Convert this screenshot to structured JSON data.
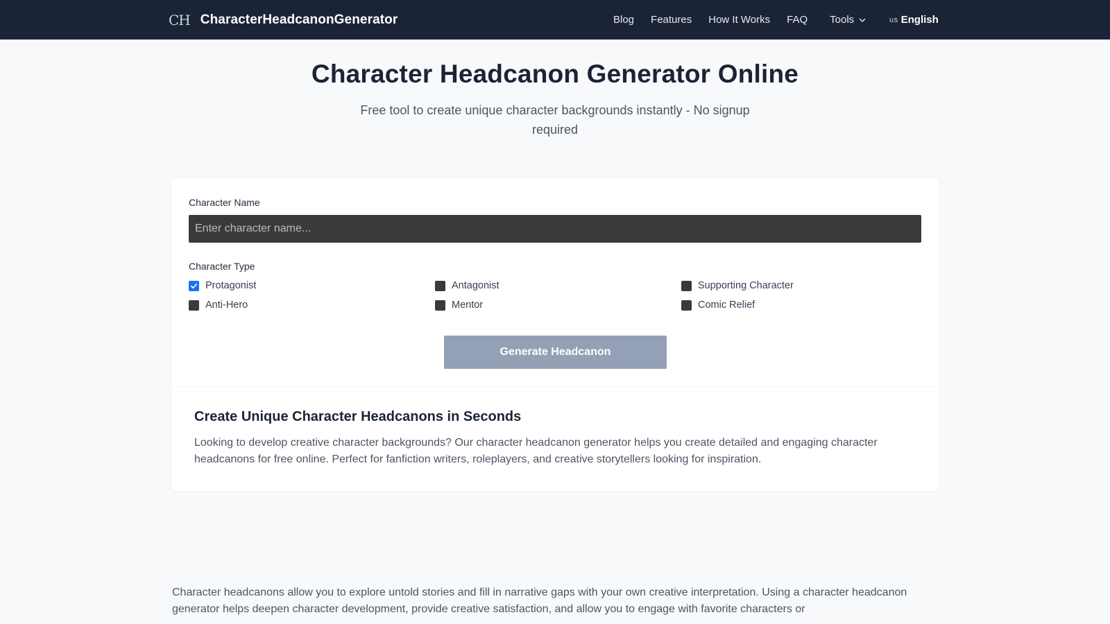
{
  "nav": {
    "logo_mark": "CH",
    "brand": "CharacterHeadcanonGenerator",
    "links": [
      "Blog",
      "Features",
      "How It Works",
      "FAQ"
    ],
    "tools_label": "Tools",
    "lang_flag": "us",
    "lang_label": "English"
  },
  "hero": {
    "title": "Character Headcanon Generator Online",
    "subtitle": "Free tool to create unique character backgrounds instantly - No signup required"
  },
  "form": {
    "name_label": "Character Name",
    "name_placeholder": "Enter character name...",
    "name_value": "",
    "type_label": "Character Type",
    "types": [
      {
        "label": "Protagonist",
        "checked": true
      },
      {
        "label": "Antagonist",
        "checked": false
      },
      {
        "label": "Supporting Character",
        "checked": false
      },
      {
        "label": "Anti-Hero",
        "checked": false
      },
      {
        "label": "Mentor",
        "checked": false
      },
      {
        "label": "Comic Relief",
        "checked": false
      }
    ],
    "generate_label": "Generate Headcanon"
  },
  "info": {
    "title": "Create Unique Character Headcanons in Seconds",
    "text": "Looking to develop creative character backgrounds? Our character headcanon generator helps you create detailed and engaging character headcanons for free online. Perfect for fanfiction writers, roleplayers, and creative storytellers looking for inspiration."
  },
  "article": {
    "text": "Character headcanons allow you to explore untold stories and fill in narrative gaps with your own creative interpretation. Using a character headcanon generator helps deepen character development, provide creative satisfaction, and allow you to engage with favorite characters or"
  },
  "colors": {
    "nav_bg": "#1b2436",
    "page_bg": "#f8f9fa",
    "input_bg": "#3a3a3a",
    "checkbox_checked": "#1a73e8",
    "button_bg": "#94a0b6"
  }
}
